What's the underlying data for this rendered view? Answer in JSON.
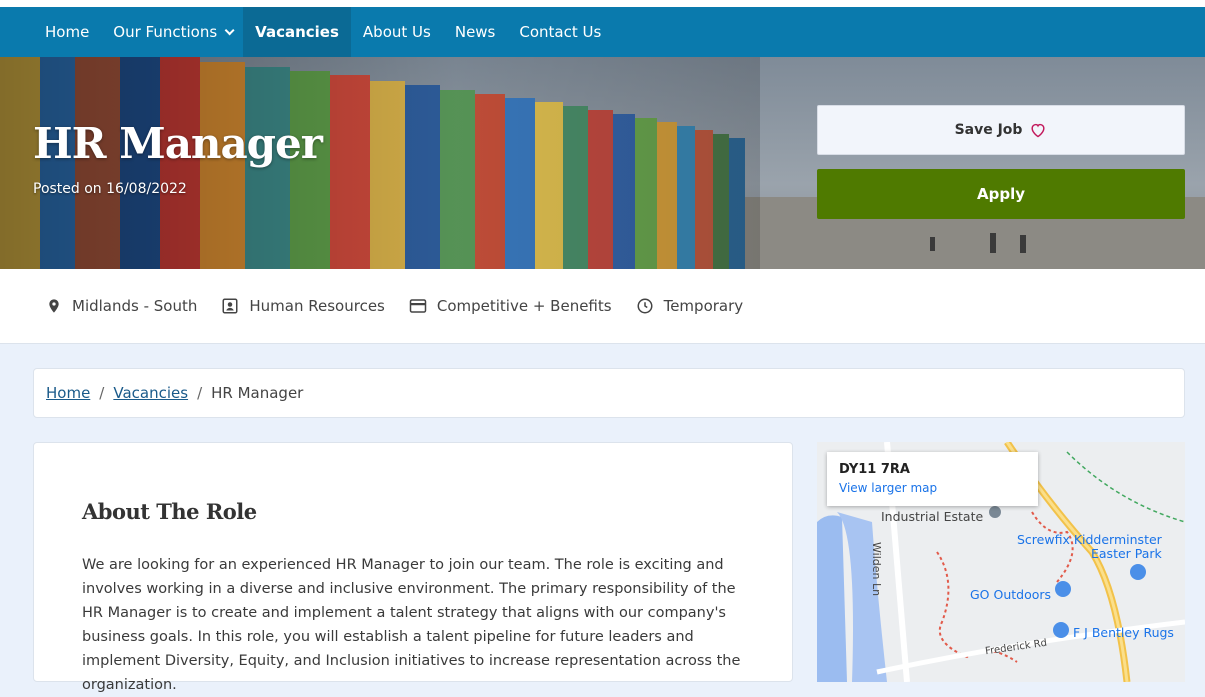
{
  "nav": {
    "items": [
      {
        "label": "Home"
      },
      {
        "label": "Our Functions"
      },
      {
        "label": "Vacancies"
      },
      {
        "label": "About Us"
      },
      {
        "label": "News"
      },
      {
        "label": "Contact Us"
      }
    ]
  },
  "hero": {
    "title": "HR Manager",
    "posted": "Posted on 16/08/2022",
    "save_label": "Save Job",
    "apply_label": "Apply"
  },
  "meta": {
    "location": "Midlands - South",
    "function": "Human Resources",
    "salary": "Competitive + Benefits",
    "type": "Temporary"
  },
  "breadcrumb": {
    "home": "Home",
    "vacancies": "Vacancies",
    "current": "HR Manager",
    "separator": "/"
  },
  "about": {
    "heading": "About The Role",
    "body": "We are looking for an experienced HR Manager to join our team. The role is exciting and involves working in a diverse and inclusive environment. The primary responsibility of the HR Manager is to create and implement a talent strategy that aligns with our company's business goals. In this role, you will establish a talent pipeline for future leaders and implement Diversity, Equity, and Inclusion initiatives to increase representation across the organization."
  },
  "map": {
    "postcode": "DY11 7RA",
    "larger_map": "View larger map",
    "labels": {
      "industrial": "Industrial Estate",
      "screwfix": "Screwfix Kidderminster",
      "easter_park": "Easter Park",
      "go_outdoors": "GO Outdoors",
      "bentley": "F J Bentley Rugs",
      "wilden": "Wilden Ln",
      "frederick": "Frederick Rd"
    }
  },
  "colors": {
    "nav": "#0a7aad",
    "nav_active": "#0b6a95",
    "apply": "#4f7a00",
    "page_bg": "#eaf1fb"
  }
}
